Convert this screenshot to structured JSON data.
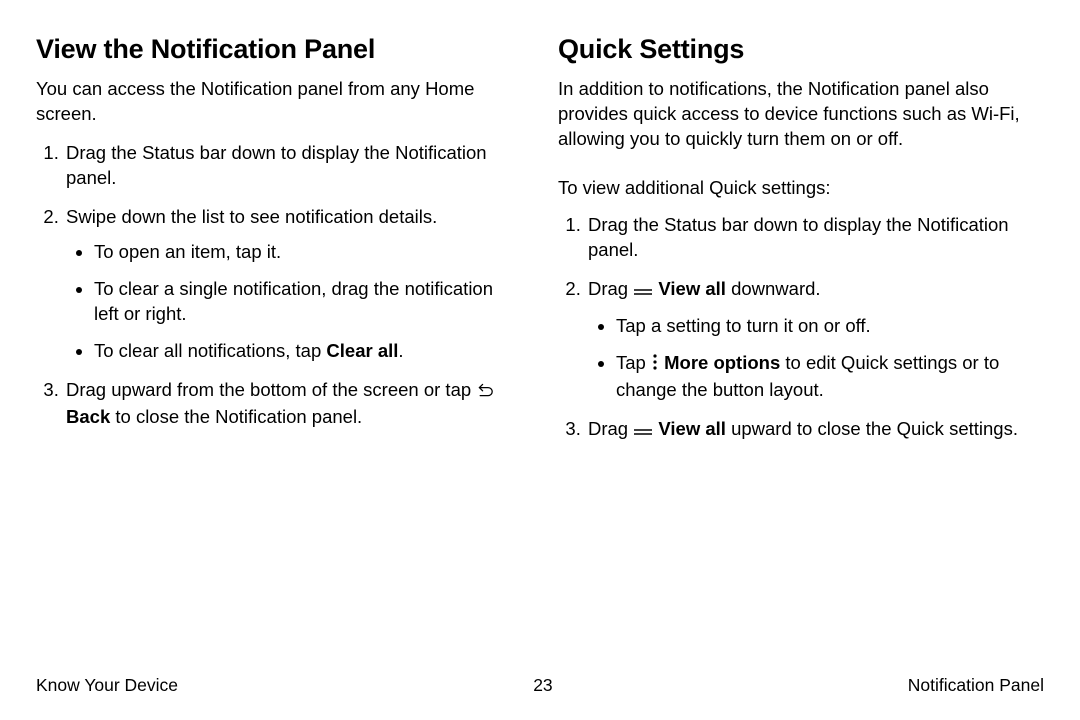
{
  "left": {
    "heading": "View the Notification Panel",
    "intro": "You can access the Notification panel from any Home screen.",
    "step1": "Drag the Status bar down to display the Notification panel.",
    "step2": "Swipe down the list to see notification details.",
    "b1": "To open an item, tap it.",
    "b2": "To clear a single notification, drag the notification left or right.",
    "b3a": "To clear all notifications, tap ",
    "b3b": "Clear all",
    "b3c": ".",
    "step3a": "Drag upward from the bottom of the screen or tap ",
    "step3b": "Back",
    "step3c": " to close the Notification panel."
  },
  "iconNames": {
    "back": "back-icon",
    "viewall": "view-all-icon",
    "more": "more-options-icon"
  },
  "right": {
    "heading": "Quick Settings",
    "intro": "In addition to notifications, the Notification panel also provides quick access to device functions such as Wi-Fi, allowing you to quickly turn them on or off.",
    "lead": "To view additional Quick settings:",
    "step1": "Drag the Status bar down to display the Notification panel.",
    "step2a": "Drag ",
    "step2b": "View all",
    "step2c": " downward.",
    "b1": "Tap a setting to turn it on or off.",
    "b2a": "Tap ",
    "b2b": "More options",
    "b2c": " to edit Quick settings or to change the button layout.",
    "step3a": "Drag ",
    "step3b": "View all",
    "step3c": " upward to close the Quick settings."
  },
  "footer": {
    "left": "Know Your Device",
    "center": "23",
    "right": "Notification Panel"
  }
}
